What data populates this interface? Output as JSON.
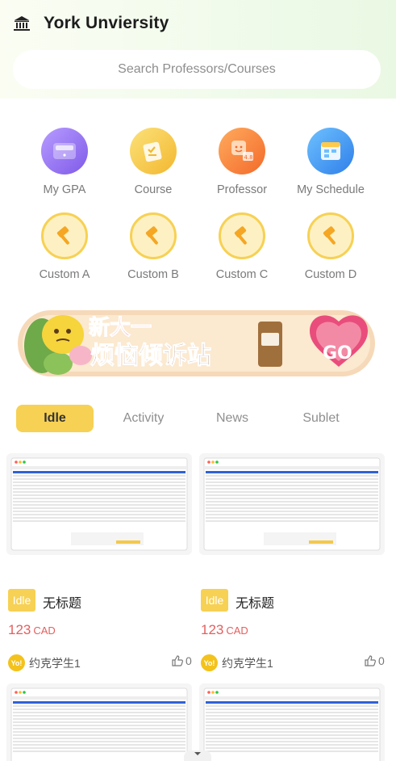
{
  "header": {
    "title": "York Unviersity",
    "logo_icon": "university-icon"
  },
  "search": {
    "placeholder": "Search Professors/Courses"
  },
  "shortcuts": [
    {
      "label": "My GPA",
      "icon": "gpa-icon",
      "color": "#9b7ff0"
    },
    {
      "label": "Course",
      "icon": "course-icon",
      "color": "#f6c84a"
    },
    {
      "label": "Professor",
      "icon": "professor-icon",
      "color": "#f58a3a"
    },
    {
      "label": "My Schedule",
      "icon": "schedule-icon",
      "color": "#4a9ff5"
    },
    {
      "label": "Custom A",
      "icon": "hammer-icon",
      "color": "#f9d862"
    },
    {
      "label": "Custom B",
      "icon": "hammer-icon",
      "color": "#f9d862"
    },
    {
      "label": "Custom C",
      "icon": "hammer-icon",
      "color": "#f9d862"
    },
    {
      "label": "Custom D",
      "icon": "hammer-icon",
      "color": "#f9d862"
    }
  ],
  "banner": {
    "headline": "新大一",
    "subline": "烦恼倾诉站",
    "button": "GO"
  },
  "tabs": [
    {
      "label": "Idle",
      "active": true
    },
    {
      "label": "Activity",
      "active": false
    },
    {
      "label": "News",
      "active": false
    },
    {
      "label": "Sublet",
      "active": false
    }
  ],
  "listings": [
    {
      "badge": "Idle",
      "title": "无标题",
      "price": "123",
      "currency": "CAD",
      "avatar": "Yo!",
      "user": "约克学生1",
      "likes": "0"
    },
    {
      "badge": "Idle",
      "title": "无标题",
      "price": "123",
      "currency": "CAD",
      "avatar": "Yo!",
      "user": "约克学生1",
      "likes": "0"
    }
  ],
  "colors": {
    "accent": "#f7d154",
    "price": "#e65e5e",
    "header_bg": "#f1fbec"
  }
}
